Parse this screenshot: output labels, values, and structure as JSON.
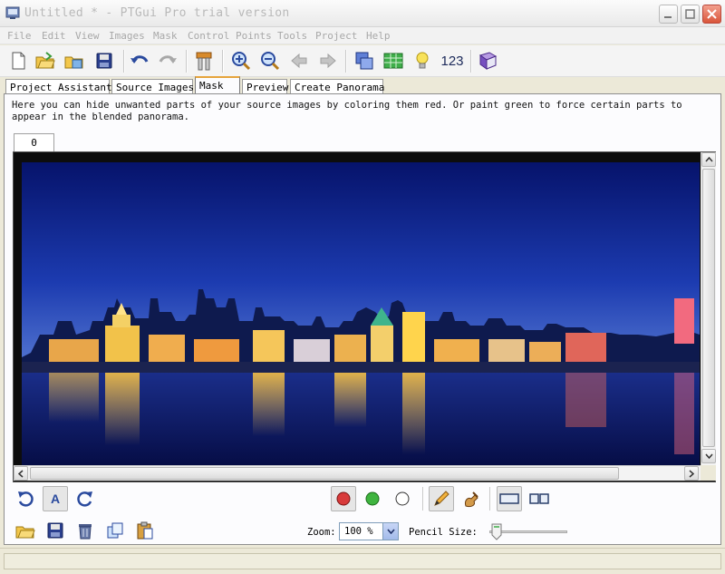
{
  "window": {
    "title": "Untitled * - PTGui Pro trial version",
    "controls": [
      "minimize-icon",
      "maximize-icon",
      "close-icon"
    ]
  },
  "menu": {
    "items": [
      "File",
      "Edit",
      "View",
      "Images",
      "Mask",
      "Control Points",
      "Tools",
      "Project",
      "Help"
    ]
  },
  "toolbar": {
    "buttons": [
      "new-project-icon",
      "open-project-icon",
      "open-recent-icon",
      "save-icon",
      "undo-icon",
      "redo-icon",
      "tools-icon",
      "zoom-in-icon",
      "zoom-out-icon",
      "back-icon",
      "forward-icon",
      "panorama-editor-icon",
      "table-icon",
      "lightbulb-icon",
      "numbers-icon",
      "help-book-icon"
    ],
    "numbers_label": "123"
  },
  "tabs": {
    "items": [
      "Project Assistant",
      "Source Images",
      "Mask",
      "Preview",
      "Create Panorama"
    ],
    "active": "Mask"
  },
  "mask": {
    "instructions": "Here you can hide unwanted parts of your source images by coloring them red. Or paint green to force certain parts to appear in the blended panorama.",
    "image_tab": "0",
    "zoom_label": "Zoom:",
    "zoom_value": "100 %",
    "pencil_label": "Pencil Size:",
    "pencil_size": 0.05
  },
  "colors": {
    "red_paint": "#d83a3a",
    "green_paint": "#3fb43f",
    "sky_top": "#0a1a7a",
    "sky_bottom": "#3f63c9",
    "water": "#0b1660",
    "active_tab_accent": "#e6a43b"
  }
}
